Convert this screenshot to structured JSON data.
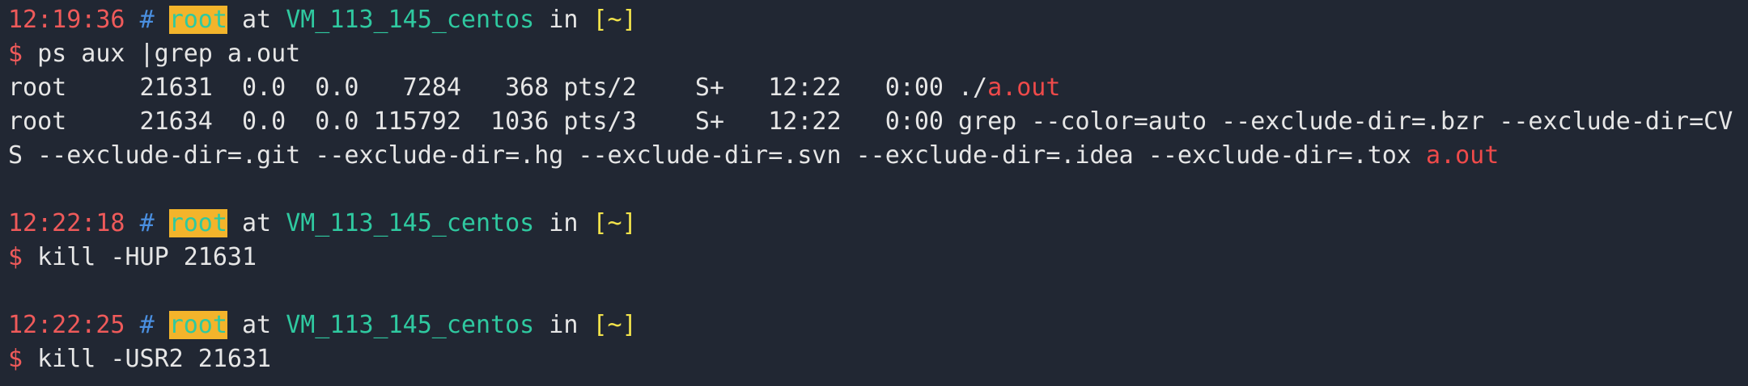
{
  "colors": {
    "background": "#212733",
    "time": "#ef5a5a",
    "hash": "#4a8fe0",
    "user_fg": "#2fc9a0",
    "user_bg": "#f3b42b",
    "host": "#2fc9a0",
    "dir": "#f1e24b",
    "dollar": "#ef5a5a",
    "match": "#ef4a4a",
    "text": "#e6e6e6"
  },
  "prompt": {
    "hash": "#",
    "user": "root",
    "at": "at",
    "host": "VM_113_145_centos",
    "in": "in",
    "dir": "[~]",
    "dollar": "$"
  },
  "blocks": [
    {
      "time": "12:19:36",
      "command": "ps aux |grep a.out",
      "output": {
        "line1_prefix": "root     21631  0.0  0.0   7284   368 pts/2    S+   12:22   0:00 ./",
        "line1_match": "a.out",
        "line2": "root     21634  0.0  0.0 115792  1036 pts/3    S+   12:22   0:00 grep --color=auto --exclude-dir=.bzr --exclude-dir=CV",
        "line3_prefix": "S --exclude-dir=.git --exclude-dir=.hg --exclude-dir=.svn --exclude-dir=.idea --exclude-dir=.tox ",
        "line3_match": "a.out"
      }
    },
    {
      "time": "12:22:18",
      "command": "kill -HUP 21631"
    },
    {
      "time": "12:22:25",
      "command": "kill -USR2 21631"
    }
  ]
}
